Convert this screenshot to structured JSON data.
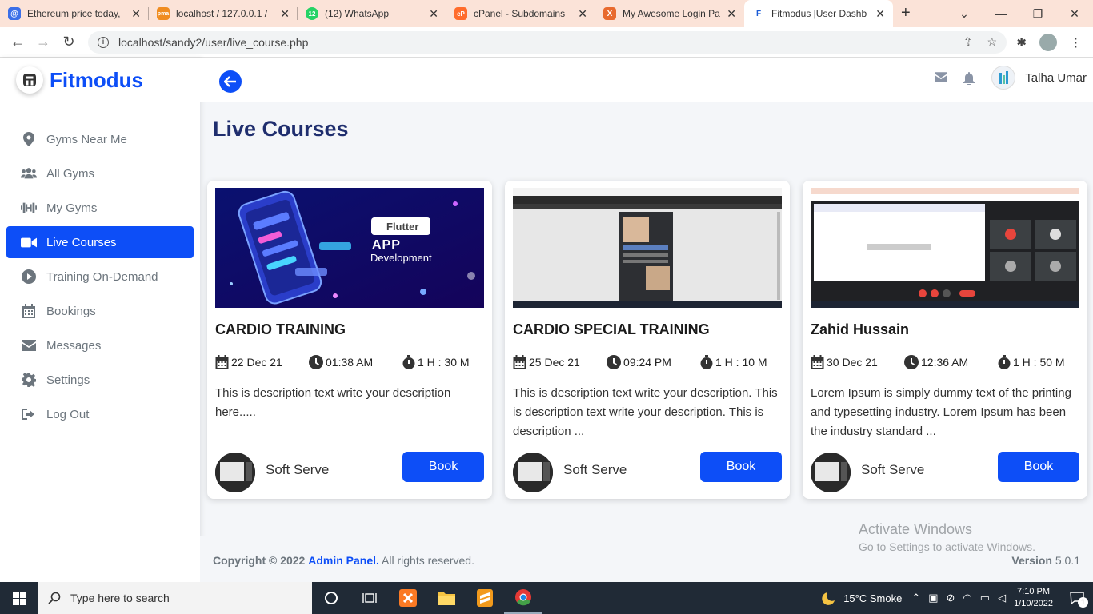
{
  "browser": {
    "tabs": [
      {
        "title": "Ethereum price today,",
        "color": "#3b6fe8",
        "glyph": "@"
      },
      {
        "title": "localhost / 127.0.0.1 /",
        "color": "#f08c20",
        "glyph": "pma"
      },
      {
        "title": "(12) WhatsApp",
        "color": "#25d366",
        "glyph": "12"
      },
      {
        "title": "cPanel - Subdomains",
        "color": "#ff6c2c",
        "glyph": "cP"
      },
      {
        "title": "My Awesome Login Pa",
        "color": "#e86a2e",
        "glyph": "X"
      },
      {
        "title": "Fitmodus |User Dashb",
        "color": "#1a5bd6",
        "glyph": "F"
      }
    ],
    "url": "localhost/sandy2/user/live_course.php"
  },
  "brand": {
    "name": "Fitmodus"
  },
  "sidebar": {
    "items": [
      {
        "label": "Gyms Near Me",
        "icon": "map-marker-icon"
      },
      {
        "label": "All Gyms",
        "icon": "users-icon"
      },
      {
        "label": "My Gyms",
        "icon": "dumbbell-icon"
      },
      {
        "label": "Live Courses",
        "icon": "video-icon",
        "active": true
      },
      {
        "label": "Training On-Demand",
        "icon": "play-circle-icon"
      },
      {
        "label": "Bookings",
        "icon": "calendar-icon"
      },
      {
        "label": "Messages",
        "icon": "envelope-icon"
      },
      {
        "label": "Settings",
        "icon": "gear-icon"
      },
      {
        "label": "Log Out",
        "icon": "sign-out-icon"
      }
    ]
  },
  "topbar": {
    "user_name": "Talha Umar"
  },
  "page": {
    "title": "Live Courses"
  },
  "cards": [
    {
      "title": "CARDIO TRAINING",
      "date": "22 Dec 21",
      "time": "01:38 AM",
      "duration": "1 H : 30 M",
      "description": "This is description text write your description here.....",
      "trainer": "Soft Serve",
      "button": "Book",
      "thumb_title": "APP",
      "thumb_sub": "Development",
      "thumb_badge": "Flutter"
    },
    {
      "title": "CARDIO SPECIAL TRAINING",
      "date": "25 Dec 21",
      "time": "09:24 PM",
      "duration": "1 H : 10 M",
      "description": "This is description text write your description. This is description text write your description. This is description ...",
      "trainer": "Soft Serve",
      "button": "Book"
    },
    {
      "title": "Zahid Hussain",
      "date": "30 Dec 21",
      "time": "12:36 AM",
      "duration": "1 H : 50 M",
      "description": "Lorem Ipsum is simply dummy text of the printing and typesetting industry. Lorem Ipsum has been the industry standard ...",
      "trainer": "Soft Serve",
      "button": "Book"
    }
  ],
  "footer": {
    "copyright_prefix": "Copyright © 2022",
    "admin_link": "Admin Panel.",
    "rights": "All rights reserved.",
    "version_label": "Version",
    "version": "5.0.1"
  },
  "watermark": {
    "line1": "Activate Windows",
    "line2": "Go to Settings to activate Windows."
  },
  "taskbar": {
    "search_placeholder": "Type here to search",
    "weather": "15°C  Smoke",
    "time": "7:10 PM",
    "date": "1/10/2022",
    "notifications": "1"
  },
  "colors": {
    "accent": "#0d4ef7",
    "title": "#1f2e6e"
  }
}
